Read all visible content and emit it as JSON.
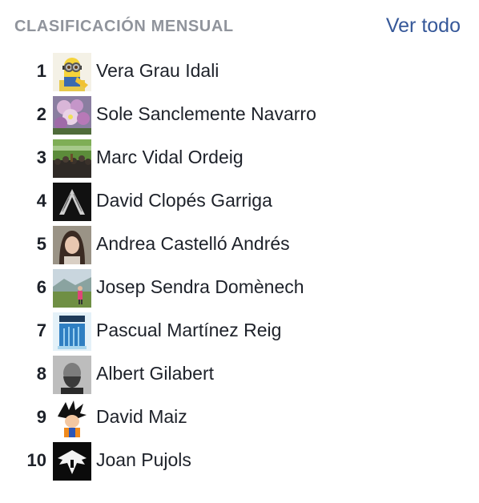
{
  "header": {
    "title": "CLASIFICACIÓN MENSUAL",
    "see_all": "Ver todo"
  },
  "colors": {
    "title": "#90949c",
    "link": "#365899",
    "text": "#1d2129"
  },
  "leaderboard": [
    {
      "rank": "1",
      "name": "Vera Grau Idali",
      "avatar": "minion-avatar"
    },
    {
      "rank": "2",
      "name": "Sole Sanclemente Navarro",
      "avatar": "flowers-avatar"
    },
    {
      "rank": "3",
      "name": "Marc Vidal Ordeig",
      "avatar": "stadium-crowd-avatar"
    },
    {
      "rank": "4",
      "name": "David Clopés Garriga",
      "avatar": "wings-avatar"
    },
    {
      "rank": "5",
      "name": "Andrea Castelló Andrés",
      "avatar": "woman-portrait-avatar"
    },
    {
      "rank": "6",
      "name": "Josep Sendra Domènech",
      "avatar": "landscape-person-avatar"
    },
    {
      "rank": "7",
      "name": "Pascual Martínez Reig",
      "avatar": "blue-poster-avatar"
    },
    {
      "rank": "8",
      "name": "Albert Gilabert",
      "avatar": "man-bw-portrait-avatar"
    },
    {
      "rank": "9",
      "name": "David Maiz",
      "avatar": "cartoon-character-avatar"
    },
    {
      "rank": "10",
      "name": "Joan Pujols",
      "avatar": "eagle-emblem-avatar"
    }
  ]
}
